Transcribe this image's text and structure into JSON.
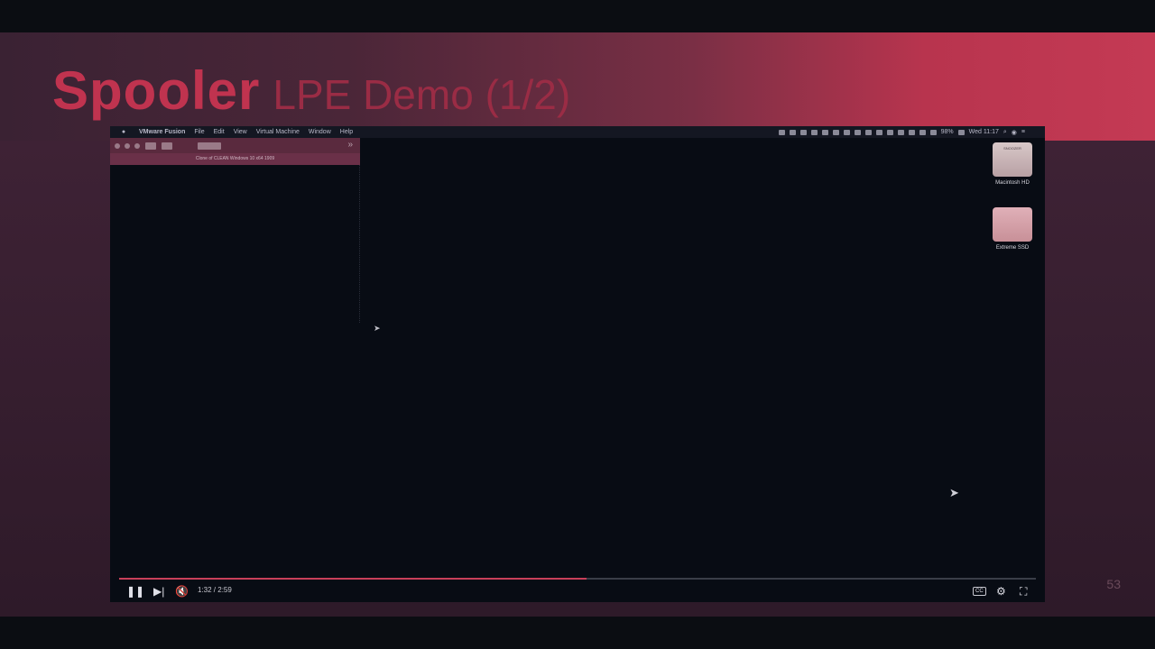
{
  "slide": {
    "title_strong": "Spooler",
    "title_light": "LPE Demo (1/2)",
    "slide_number": "53"
  },
  "menubar": {
    "apple_icon": "apple-icon",
    "items": [
      "VMware Fusion",
      "File",
      "Edit",
      "View",
      "Virtual Machine",
      "Window",
      "Help"
    ],
    "battery": "98%",
    "clock": "Wed 11:17"
  },
  "vm_window": {
    "title": "Clone of CLEAN Windows 10 x64 1909",
    "chevron": "»"
  },
  "desktop": {
    "icons": [
      {
        "label": "Macintosh HD",
        "drive_text": "SNOOZER"
      },
      {
        "label": "Extreme SSD"
      }
    ]
  },
  "player": {
    "time": "1:32 / 2:59",
    "progress": 0.51,
    "cc_label": "CC",
    "play_icon": "pause-icon",
    "next_icon": "next-icon",
    "mute_icon": "muted-speaker-icon",
    "settings_icon": "gear-icon",
    "fullscreen_icon": "fullscreen-icon"
  },
  "colors": {
    "accent": "#c0334f",
    "progress": "#c8405a"
  }
}
